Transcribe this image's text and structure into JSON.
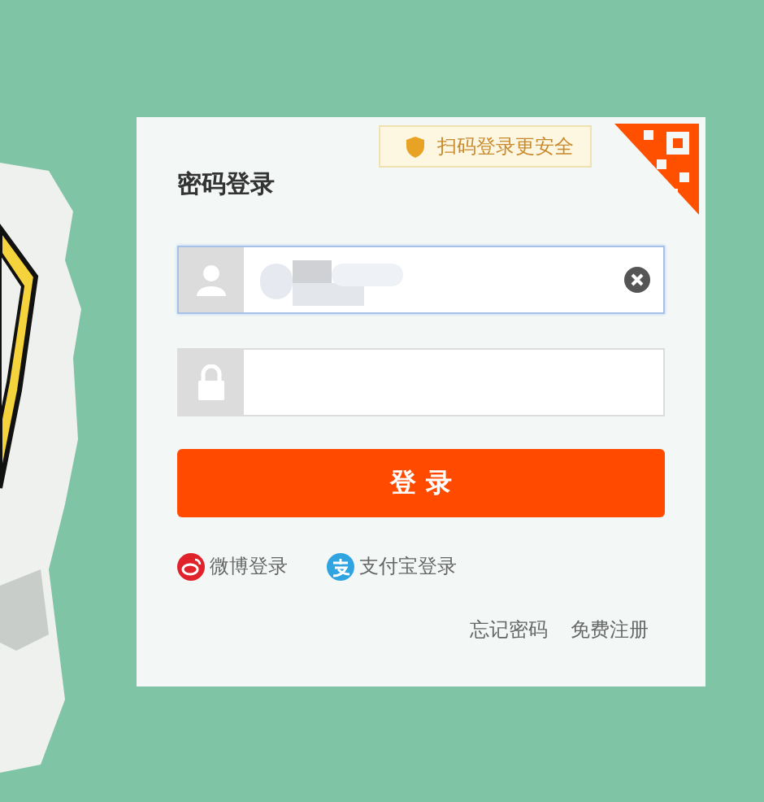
{
  "login_panel": {
    "title": "密码登录",
    "qr_tip": "扫码登录更安全",
    "username_field": {
      "focused": true,
      "redacted": true
    },
    "password_field": {
      "focused": false
    },
    "submit_button": "登 录",
    "social_logins": [
      {
        "kind": "weibo",
        "label": "微博登录"
      },
      {
        "kind": "alipay",
        "label": "支付宝登录"
      }
    ],
    "footer_links": [
      "忘记密码",
      "免费注册"
    ]
  }
}
